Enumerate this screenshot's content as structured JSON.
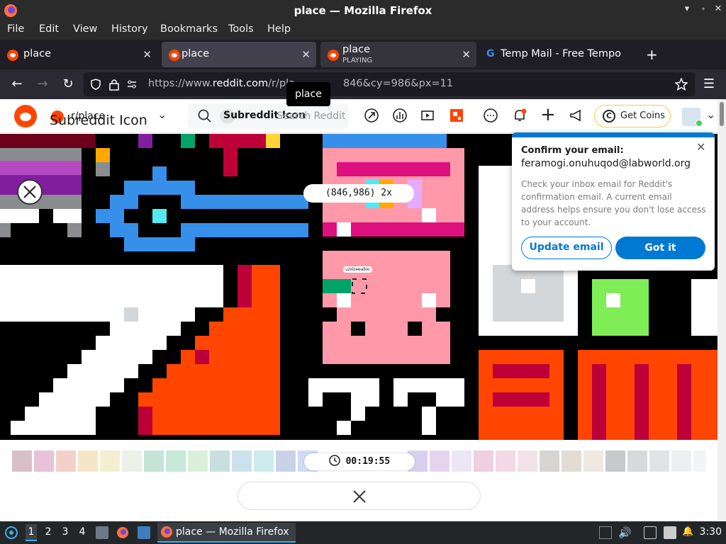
{
  "window": {
    "title": "place — Mozilla Firefox"
  },
  "menu": [
    "File",
    "Edit",
    "View",
    "History",
    "Bookmarks",
    "Tools",
    "Help"
  ],
  "tabs": [
    {
      "label": "place"
    },
    {
      "label": "place"
    },
    {
      "label": "place",
      "sub": "PLAYING"
    },
    {
      "label": "Temp Mail - Free Tempora"
    }
  ],
  "url": {
    "prefix": "https://www.",
    "domain": "reddit.com",
    "path": "/r/pla",
    "tail": "846&cy=986&px=11"
  },
  "tooltip": "place",
  "header": {
    "subreddit": "r/place",
    "subreddit_icon_alt": "Subreddit Icon",
    "search_chip": "Subreddit Icon",
    "search_placeholder": "Search Reddit",
    "coins": "Get Coins"
  },
  "canvas": {
    "coord": "(846,986) 2x",
    "user_tag": "u/elzeeablo",
    "timer": "00:19:55"
  },
  "popup": {
    "title": "Confirm your email:",
    "email": "feramogi.onuhuqod@labworld.org",
    "body": "Check your inbox email for Reddit's confirmation email. A current email address helps ensure you don't lose access to your account.",
    "update_btn": "Update email",
    "ok_btn": "Got it"
  },
  "taskbar": {
    "workspaces": [
      "1",
      "2",
      "3",
      "4"
    ],
    "window": "place — Mozilla Firefox",
    "clock": "3:30"
  },
  "colors": {
    "reddit": "#ff4500",
    "blue": "#0079d3"
  }
}
